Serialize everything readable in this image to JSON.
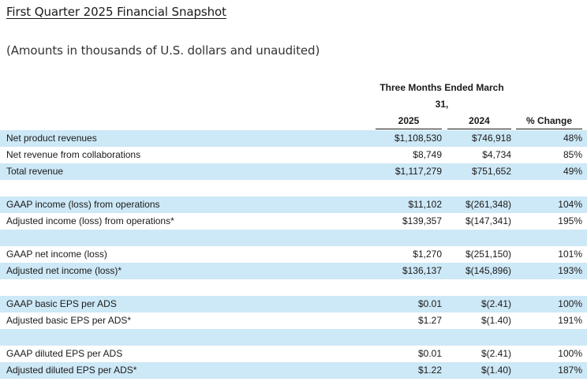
{
  "title": "First Quarter 2025 Financial Snapshot",
  "subtitle": "(Amounts in thousands of U.S. dollars and unaudited)",
  "table": {
    "period_header": "Three Months Ended March 31,",
    "columns": [
      "2025",
      "2024",
      "% Change"
    ],
    "rows": [
      {
        "label": "Net product revenues",
        "v2025": "$1,108,530",
        "v2024": "$746,918",
        "change": "48%",
        "shaded": true
      },
      {
        "label": "Net revenue from collaborations",
        "v2025": "$8,749",
        "v2024": "$4,734",
        "change": "85%",
        "shaded": false
      },
      {
        "label": "Total revenue",
        "v2025": "$1,117,279",
        "v2024": "$751,652",
        "change": "49%",
        "shaded": true
      },
      {
        "label": "",
        "v2025": "",
        "v2024": "",
        "change": "",
        "shaded": false
      },
      {
        "label": "GAAP income (loss) from operations",
        "v2025": "$11,102",
        "v2024": "$(261,348)",
        "change": "104%",
        "shaded": true
      },
      {
        "label": "Adjusted income (loss) from operations*",
        "v2025": "$139,357",
        "v2024": "$(147,341)",
        "change": "195%",
        "shaded": false
      },
      {
        "label": "",
        "v2025": "",
        "v2024": "",
        "change": "",
        "shaded": true
      },
      {
        "label": "GAAP net income (loss)",
        "v2025": "$1,270",
        "v2024": "$(251,150)",
        "change": "101%",
        "shaded": false
      },
      {
        "label": "Adjusted net income (loss)*",
        "v2025": "$136,137",
        "v2024": "$(145,896)",
        "change": "193%",
        "shaded": true
      },
      {
        "label": "",
        "v2025": "",
        "v2024": "",
        "change": "",
        "shaded": false
      },
      {
        "label": "GAAP basic EPS per ADS",
        "v2025": "$0.01",
        "v2024": "$(2.41)",
        "change": "100%",
        "shaded": true
      },
      {
        "label": "Adjusted basic EPS per ADS*",
        "v2025": "$1.27",
        "v2024": "$(1.40)",
        "change": "191%",
        "shaded": false
      },
      {
        "label": "",
        "v2025": "",
        "v2024": "",
        "change": "",
        "shaded": true
      },
      {
        "label": "GAAP diluted EPS per ADS",
        "v2025": "$0.01",
        "v2024": "$(2.41)",
        "change": "100%",
        "shaded": false
      },
      {
        "label": "Adjusted diluted EPS per ADS*",
        "v2025": "$1.22",
        "v2024": "$(1.40)",
        "change": "187%",
        "shaded": true
      }
    ]
  },
  "colors": {
    "row_shade": "#cde8f6",
    "text": "#1a1a1a"
  }
}
